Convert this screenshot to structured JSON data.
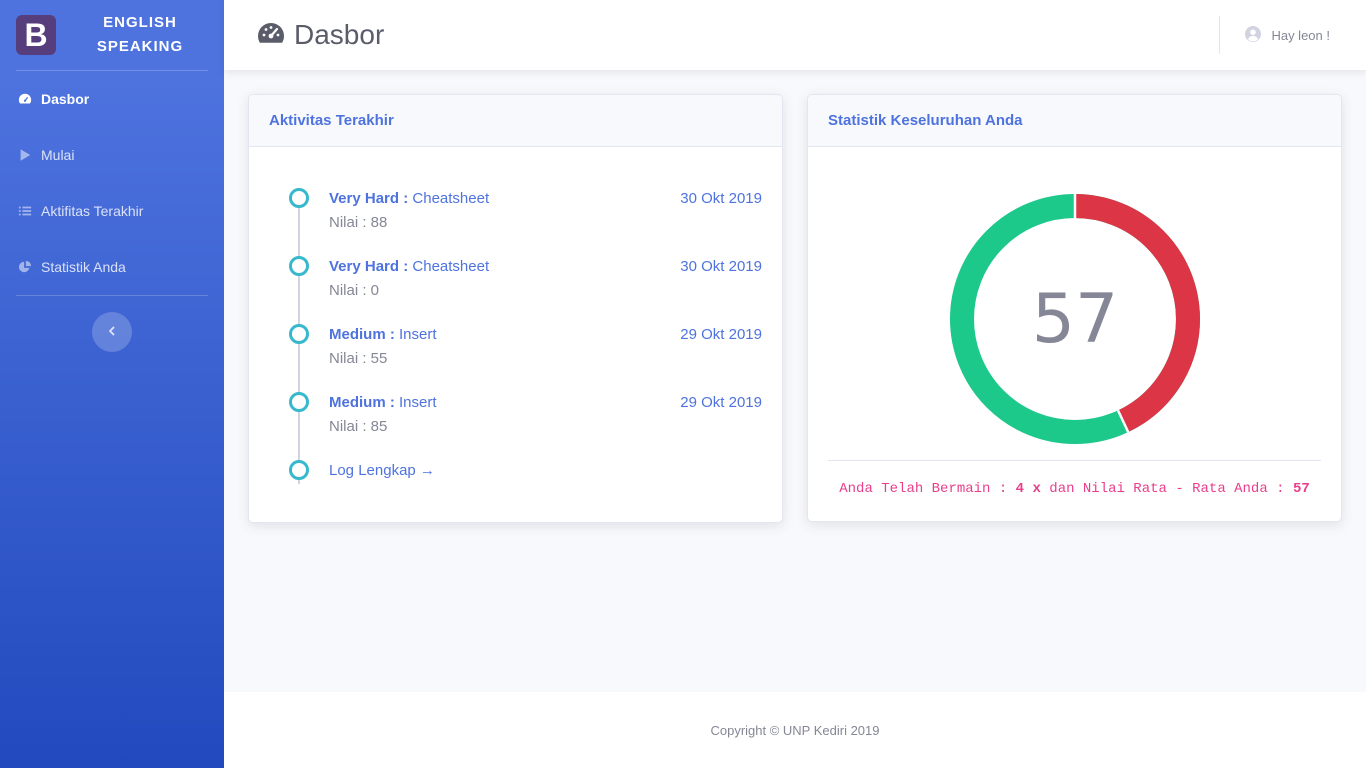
{
  "sidebar": {
    "brand_letter": "B",
    "brand_line1": "ENGLISH",
    "brand_line2": "SPEAKING",
    "items": [
      {
        "label": "Dasbor",
        "icon": "tachometer-icon",
        "active": true
      },
      {
        "label": "Mulai",
        "icon": "play-icon"
      },
      {
        "label": "Aktifitas Terakhir",
        "icon": "list-icon"
      },
      {
        "label": "Statistik Anda",
        "icon": "pie-chart-icon"
      }
    ],
    "toggle_icon": "chevron-left-icon"
  },
  "topbar": {
    "title": "Dasbor",
    "user_greeting": "Hay leon !"
  },
  "activity": {
    "header": "Aktivitas Terakhir",
    "items": [
      {
        "level": "Very Hard :",
        "category": "Cheatsheet",
        "date": "30 Okt 2019",
        "score": "Nilai : 88"
      },
      {
        "level": "Very Hard :",
        "category": "Cheatsheet",
        "date": "30 Okt 2019",
        "score": "Nilai : 0"
      },
      {
        "level": "Medium :",
        "category": "Insert",
        "date": "29 Okt 2019",
        "score": "Nilai : 55"
      },
      {
        "level": "Medium :",
        "category": "Insert",
        "date": "29 Okt 2019",
        "score": "Nilai : 85"
      }
    ],
    "full_log_link": "Log Lengkap →"
  },
  "stats": {
    "header": "Statistik Keseluruhan Anda",
    "average": "57",
    "donut_fraction": 0.43,
    "colors": {
      "correct": "#1cc88a",
      "remaining": "#dc3545"
    },
    "summary_prefix": "Anda Telah Bermain : ",
    "play_count": "4 x",
    "summary_middle": " dan Nilai Rata - Rata Anda : ",
    "average_value": "57"
  },
  "footer": {
    "copyright": "Copyright © UNP Kediri 2019"
  }
}
